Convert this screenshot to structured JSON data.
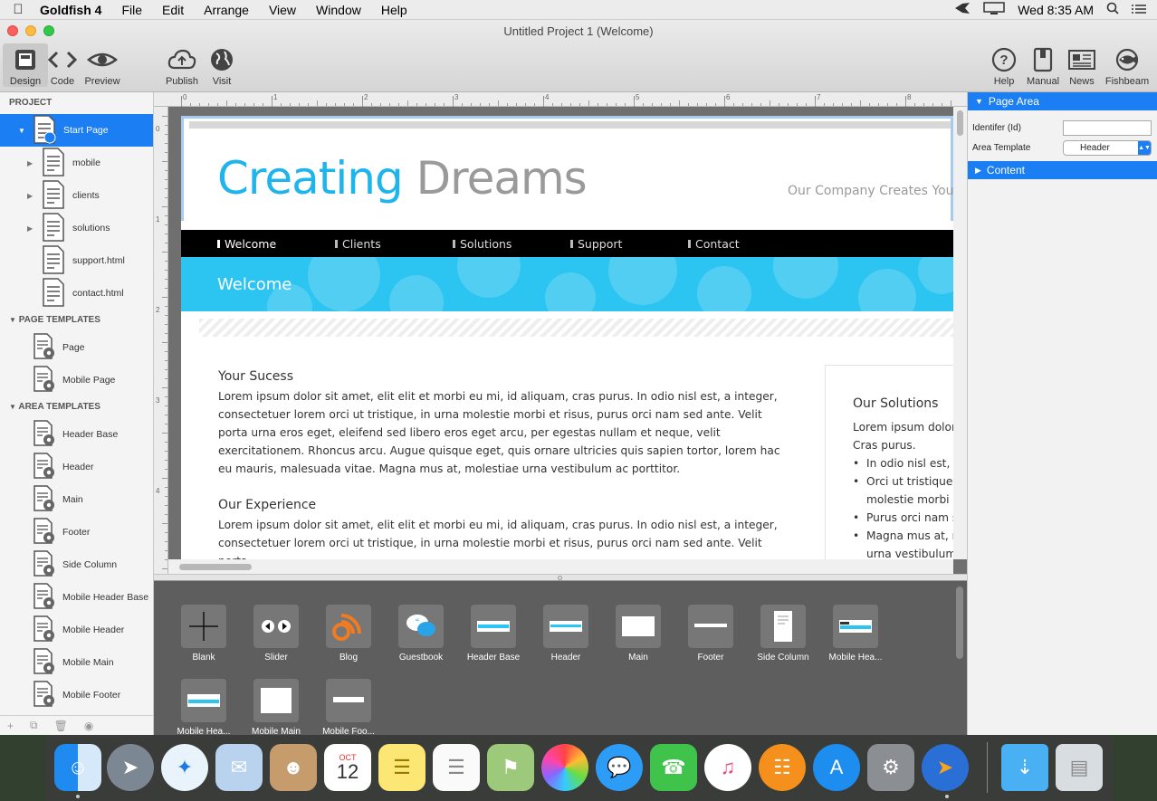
{
  "menubar": {
    "app": "Goldfish 4",
    "items": [
      "File",
      "Edit",
      "Arrange",
      "View",
      "Window",
      "Help"
    ],
    "clock": "Wed 8:35 AM"
  },
  "window": {
    "title": "Untitled Project 1 (Welcome)",
    "toolbar": {
      "design": "Design",
      "code": "Code",
      "preview": "Preview",
      "publish": "Publish",
      "visit": "Visit",
      "help": "Help",
      "manual": "Manual",
      "news": "News",
      "fishbeam": "Fishbeam"
    }
  },
  "sidebar": {
    "project_header": "PROJECT",
    "pages": [
      {
        "label": "Start Page",
        "selected": true
      },
      {
        "label": "mobile"
      },
      {
        "label": "clients"
      },
      {
        "label": "solutions"
      },
      {
        "label": "support.html"
      },
      {
        "label": "contact.html"
      }
    ],
    "page_templates_header": "PAGE TEMPLATES",
    "page_templates": [
      "Page",
      "Mobile Page"
    ],
    "area_templates_header": "AREA TEMPLATES",
    "area_templates": [
      "Header Base",
      "Header",
      "Main",
      "Footer",
      "Side Column",
      "Mobile Header Base",
      "Mobile Header",
      "Mobile Main",
      "Mobile Footer"
    ]
  },
  "ruler": {
    "top": [
      "0",
      "1",
      "2",
      "3",
      "4",
      "5",
      "6",
      "7",
      "8"
    ],
    "left": [
      "0",
      "1",
      "2",
      "3",
      "4"
    ]
  },
  "site": {
    "title_1": "Creating",
    "title_2": "Dreams",
    "tagline": "Our Company Creates Your",
    "nav": [
      "Welcome",
      "Clients",
      "Solutions",
      "Support",
      "Contact"
    ],
    "banner": "Welcome",
    "h1": "Your Sucess",
    "p1": "Lorem ipsum dolor sit amet, elit elit et morbi eu mi, id aliquam, cras purus. In odio nisl est, a integer, consectetuer lorem orci ut tristique, in urna molestie morbi et risus, purus orci nam sed ante. Velit porta urna eros eget, eleifend sed libero eros eget arcu, per egestas nullam et neque, velit exercitationem. Rhoncus arcu. Augue quisque eget, quis ornare ultricies quis sapien tortor, lorem hac eu mauris, malesuada vitae. Magna mus at, molestiae urna vestibulum ac porttitor.",
    "h2": "Our Experience",
    "p2": "Lorem ipsum dolor sit amet, elit elit et morbi eu mi, id aliquam, cras purus. In odio nisl est, a integer, consectetuer lorem orci ut tristique, in urna molestie morbi et risus, purus orci nam sed ante. Velit porta",
    "side_h": "Our Solutions",
    "side_p_1": "Lorem ipsum dolor",
    "side_p_2": "Cras purus.",
    "side_list": [
      "In odio nisl est, a",
      "Orci ut tristique,",
      "molestie morbi e",
      "Purus orci nam s",
      "Magna mus at, m",
      "urna vestibulum"
    ]
  },
  "library": {
    "items": [
      "Blank",
      "Slider",
      "Blog",
      "Guestbook",
      "Header Base",
      "Header",
      "Main",
      "Footer",
      "Side Column",
      "Mobile Hea...",
      "Mobile Hea...",
      "Mobile Main",
      "Mobile Foo..."
    ]
  },
  "inspector": {
    "page_area": "Page Area",
    "identifier_label": "Identifer (Id)",
    "identifier_value": "",
    "template_label": "Area Template",
    "template_value": "Header",
    "content": "Content"
  },
  "dock": {
    "calendar_month": "OCT",
    "calendar_day": "12"
  },
  "colors": {
    "accent": "#1b7ef3",
    "site_title_blue": "#1fb5ec",
    "site_title_gray": "#9a9a9a",
    "banner": "#2cc4f0"
  }
}
